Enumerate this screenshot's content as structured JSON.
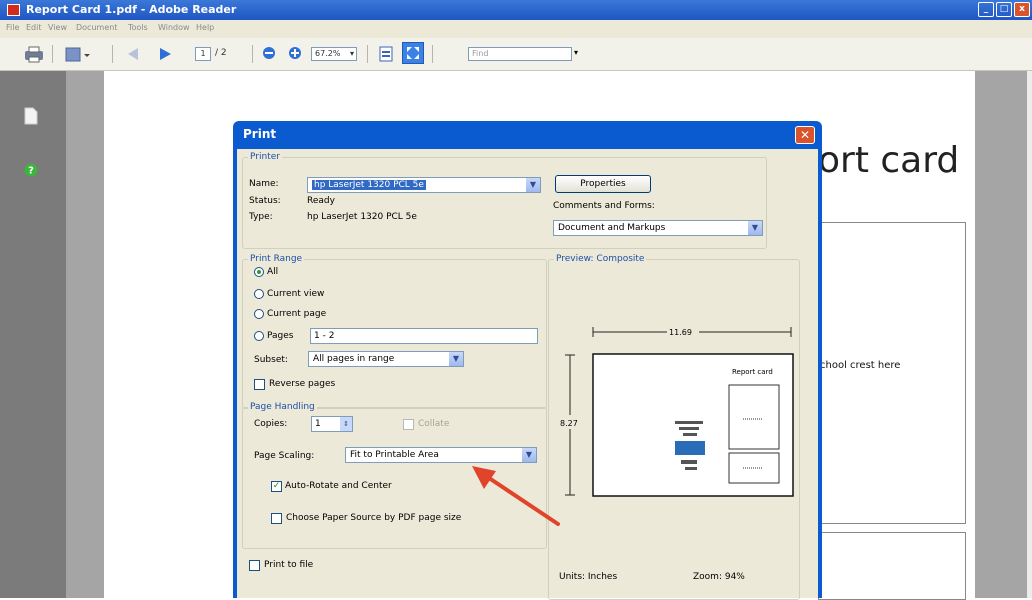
{
  "window": {
    "title": "Report Card 1.pdf - Adobe Reader"
  },
  "menu": [
    "File",
    "Edit",
    "View",
    "Document",
    "Tools",
    "Window",
    "Help"
  ],
  "toolbar": {
    "page_current": "1",
    "page_total": "/ 2",
    "zoom": "67.2%",
    "find_placeholder": "Find"
  },
  "document": {
    "title_fragment": "ort card",
    "crest_text": "chool crest here"
  },
  "dialog": {
    "title": "Print",
    "printer": {
      "legend": "Printer",
      "name_label": "Name:",
      "name_value": "hp LaserJet 1320 PCL 5e",
      "status_label": "Status:",
      "status_value": "Ready",
      "type_label": "Type:",
      "type_value": "hp LaserJet 1320 PCL 5e",
      "properties_button": "Properties",
      "comments_label": "Comments and Forms:",
      "comments_value": "Document and Markups"
    },
    "print_range": {
      "legend": "Print Range",
      "all_label": "All",
      "current_view_label": "Current view",
      "current_page_label": "Current page",
      "pages_label": "Pages",
      "pages_value": "1 - 2",
      "subset_label": "Subset:",
      "subset_value": "All pages in range",
      "reverse_label": "Reverse pages"
    },
    "page_handling": {
      "legend": "Page Handling",
      "copies_label": "Copies:",
      "copies_value": "1",
      "collate_label": "Collate",
      "scaling_label": "Page Scaling:",
      "scaling_value": "Fit to Printable Area",
      "auto_rotate_label": "Auto-Rotate and Center",
      "paper_source_label": "Choose Paper Source by PDF page size"
    },
    "print_to_file_label": "Print to file",
    "preview": {
      "legend": "Preview: Composite",
      "width_dim": "11.69",
      "height_dim": "8.27",
      "thumb_title": "Report card",
      "units": "Units: Inches",
      "zoom": "Zoom: 94%"
    }
  },
  "colors": {
    "dialog_frame": "#0a5ad0",
    "dialog_body": "#ece9d8",
    "arrow": "#e0452b",
    "selection": "#316ac5"
  }
}
